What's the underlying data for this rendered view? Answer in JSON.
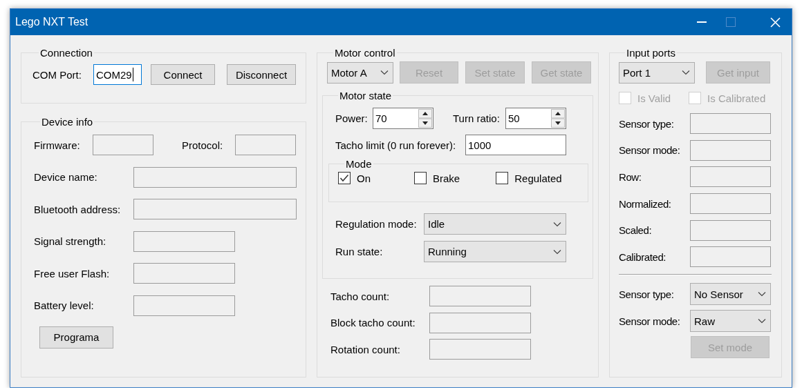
{
  "window": {
    "title": "Lego NXT Test"
  },
  "connection": {
    "title": "Connection",
    "com_port_label": "COM Port:",
    "com_port": "COM29",
    "buttons": [
      {
        "label": "Connect",
        "disabled": false
      },
      {
        "label": "Disconnect",
        "disabled": false
      }
    ]
  },
  "device_info": {
    "title": "Device info",
    "fields": [
      {
        "label": "Firmware:"
      },
      {
        "label": "Protocol:"
      },
      {
        "label": "Device name:"
      },
      {
        "label": "Bluetooth address:"
      },
      {
        "label": "Signal strength:"
      },
      {
        "label": "Free user Flash:"
      },
      {
        "label": "Battery level:"
      }
    ],
    "button": {
      "label": "Programa",
      "disabled": false
    }
  },
  "motor_control": {
    "title": "Motor control",
    "motor": "Motor A",
    "buttons": [
      {
        "label": "Reset",
        "disabled": true
      },
      {
        "label": "Set state",
        "disabled": true
      },
      {
        "label": "Get state",
        "disabled": true
      }
    ],
    "motor_state": {
      "title": "Motor state",
      "power_label": "Power:",
      "power": "70",
      "turn_ratio_label": "Turn ratio:",
      "turn_ratio": "50",
      "tacho_limit_label": "Tacho limit (0 run forever):",
      "tacho_limit": "1000",
      "mode": {
        "title": "Mode",
        "options": [
          {
            "label": "On",
            "checked": true
          },
          {
            "label": "Brake",
            "checked": false
          },
          {
            "label": "Regulated",
            "checked": false
          }
        ]
      },
      "regulation_mode_label": "Regulation mode:",
      "regulation_mode": "Idle",
      "run_state_label": "Run state:",
      "run_state": "Running"
    },
    "counts": [
      {
        "label": "Tacho count:"
      },
      {
        "label": "Block tacho count:"
      },
      {
        "label": "Rotation count:"
      }
    ]
  },
  "input_ports": {
    "title": "Input ports",
    "port": "Port 1",
    "get_input": {
      "label": "Get input",
      "disabled": true
    },
    "flags": [
      {
        "label": "Is Valid",
        "checked": false,
        "disabled": true
      },
      {
        "label": "Is Calibrated",
        "checked": false,
        "disabled": true
      }
    ],
    "readings": [
      {
        "label": "Sensor type:"
      },
      {
        "label": "Sensor mode:"
      },
      {
        "label": "Row:"
      },
      {
        "label": "Normalized:"
      },
      {
        "label": "Scaled:"
      },
      {
        "label": "Calibrated:"
      }
    ],
    "sensor_type_label": "Sensor type:",
    "sensor_type": "No Sensor",
    "sensor_mode_label": "Sensor mode:",
    "sensor_mode": "Raw",
    "set_mode": {
      "label": "Set mode",
      "disabled": true
    }
  }
}
